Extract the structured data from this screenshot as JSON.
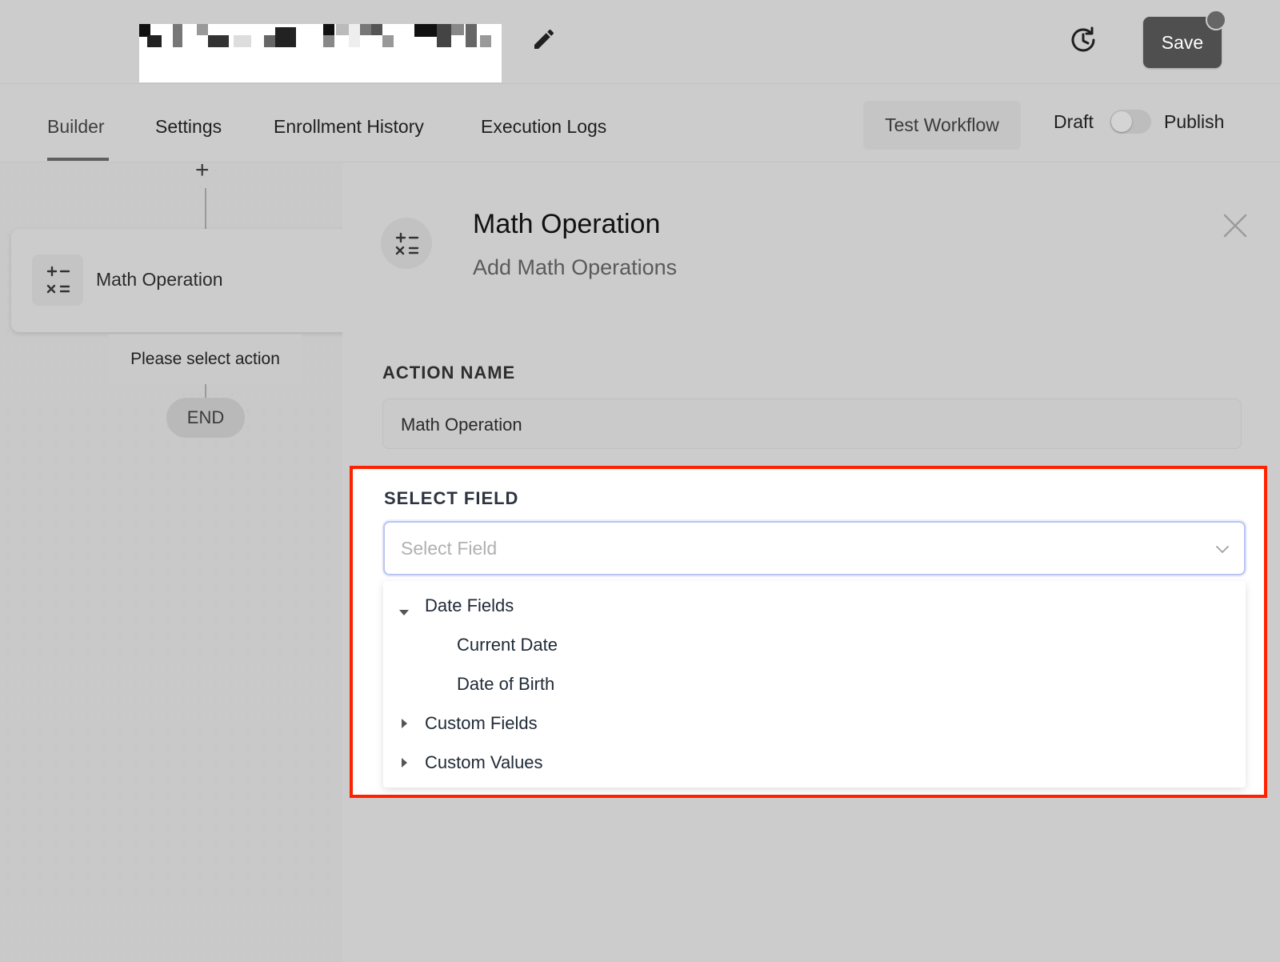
{
  "header": {
    "save_label": "Save"
  },
  "tabs": [
    {
      "label": "Builder"
    },
    {
      "label": "Settings"
    },
    {
      "label": "Enrollment History"
    },
    {
      "label": "Execution Logs"
    }
  ],
  "toolbar": {
    "test_workflow_label": "Test Workflow",
    "draft_label": "Draft",
    "publish_label": "Publish",
    "publish_toggle_on": false
  },
  "canvas": {
    "add_symbol": "+",
    "node_label": "Math Operation",
    "warning": "Please select action",
    "end_label": "END"
  },
  "panel": {
    "title": "Math Operation",
    "subtitle": "Add Math Operations",
    "action_name_label": "ACTION NAME",
    "action_name_value": "Math Operation",
    "select_field_label": "SELECT FIELD",
    "select_field_placeholder": "Select Field",
    "dropdown": {
      "groups": [
        {
          "label": "Date Fields",
          "expanded": true,
          "items": [
            "Current Date",
            "Date of Birth"
          ]
        },
        {
          "label": "Custom Fields",
          "expanded": false
        },
        {
          "label": "Custom Values",
          "expanded": false
        }
      ]
    }
  },
  "colors": {
    "highlight_border": "#ff2200",
    "save_button": "#4f4f4f",
    "select_focus_border": "#b9c4f2"
  },
  "icons": {
    "edit": "pencil-icon",
    "history": "history-icon",
    "close": "close-icon",
    "math": "math-operations-icon"
  }
}
